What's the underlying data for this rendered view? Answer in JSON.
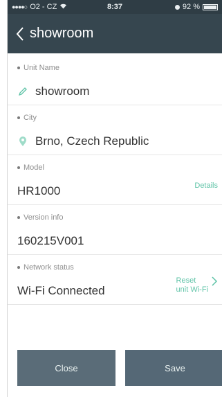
{
  "statusbar": {
    "carrier": "O2 - CZ",
    "time": "8:37",
    "battery": "92 %"
  },
  "navbar": {
    "back_icon": "chevron-left-icon",
    "title": "showroom"
  },
  "fields": {
    "unit_name": {
      "label": "Unit Name",
      "value": "showroom",
      "icon": "pencil-icon"
    },
    "city": {
      "label": "City",
      "value": "Brno, Czech Republic",
      "icon": "location-pin-icon"
    },
    "model": {
      "label": "Model",
      "value": "HR1000",
      "link": "Details"
    },
    "version": {
      "label": "Version info",
      "value": "160215V001"
    },
    "network": {
      "label": "Network status",
      "value": "Wi-Fi Connected",
      "link_line1": "Reset",
      "link_line2": "unit Wi-Fi"
    }
  },
  "buttons": {
    "close": "Close",
    "save": "Save"
  },
  "colors": {
    "navbar": "#36464f",
    "accent": "#5fc3a7",
    "button": "#5a6c78"
  }
}
